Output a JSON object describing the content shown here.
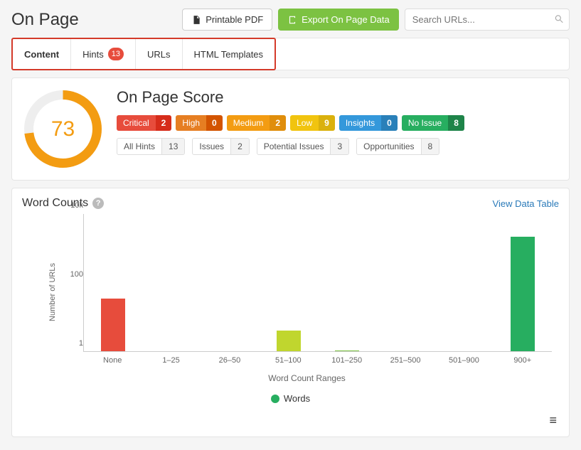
{
  "header": {
    "title": "On Page",
    "printable_label": "Printable PDF",
    "export_label": "Export On Page Data",
    "search_placeholder": "Search URLs..."
  },
  "tabs": {
    "content": "Content",
    "hints": "Hints",
    "hints_count": "13",
    "urls": "URLs",
    "templates": "HTML Templates"
  },
  "score": {
    "title": "On Page Score",
    "value": "73",
    "pills": [
      {
        "key": "critical",
        "label": "Critical",
        "count": "2"
      },
      {
        "key": "high",
        "label": "High",
        "count": "0"
      },
      {
        "key": "medium",
        "label": "Medium",
        "count": "2"
      },
      {
        "key": "low",
        "label": "Low",
        "count": "9"
      },
      {
        "key": "insights",
        "label": "Insights",
        "count": "0"
      },
      {
        "key": "noissue",
        "label": "No Issue",
        "count": "8"
      }
    ],
    "chips": [
      {
        "label": "All Hints",
        "count": "13"
      },
      {
        "label": "Issues",
        "count": "2"
      },
      {
        "label": "Potential Issues",
        "count": "3"
      },
      {
        "label": "Opportunities",
        "count": "8"
      }
    ]
  },
  "word_counts": {
    "title": "Word Counts",
    "view_table": "View Data Table",
    "y_label": "Number of URLs",
    "y_ticks": [
      "1",
      "100",
      "10k"
    ],
    "x_label": "Word Count Ranges",
    "legend": "Words"
  },
  "chart_data": {
    "type": "bar",
    "title": "Word Counts",
    "xlabel": "Word Count Ranges",
    "ylabel": "Number of URLs",
    "yscale": "log",
    "ylim": [
      1,
      10000
    ],
    "categories": [
      "None",
      "1–25",
      "26–50",
      "51–100",
      "101–250",
      "251–500",
      "501–900",
      "900+"
    ],
    "series": [
      {
        "name": "Words",
        "color": "#27ae60",
        "values": [
          35,
          0,
          0,
          4,
          1,
          0,
          0,
          2200
        ],
        "bar_colors": [
          "#e74c3c",
          null,
          null,
          "#c0d62e",
          "#7cc242",
          null,
          null,
          "#27ae60"
        ]
      }
    ]
  }
}
